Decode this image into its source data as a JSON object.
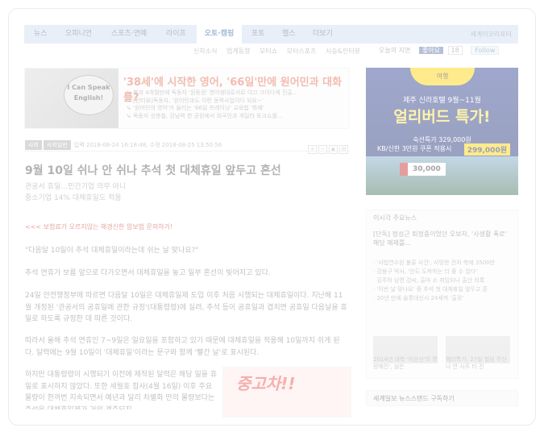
{
  "nav": {
    "items": [
      "뉴스",
      "오피니언",
      "스포츠·연예",
      "라이프",
      "오토·캠핑",
      "포토",
      "헬스",
      "더보기"
    ],
    "active": "오토·캠핑",
    "brand": "세계이코리포터"
  },
  "subnav": [
    "신차소식",
    "업계동향",
    "모터쇼",
    "모터스포츠",
    "시승&인터뷰"
  ],
  "social": {
    "today": "오늘의 지면",
    "facebook": "좋아요",
    "count": "18",
    "twitter": "Follow"
  },
  "promo": {
    "bubble_line1": "I Can Speak",
    "bubble_line2": "English!",
    "headline": "'38세'에 시작한 영어, '66일'만에 원어민과 대화를?",
    "items": [
      "볼과 4개월만에 독동자 '원동점' 영어생대로서로 이끄 크이다게 진출..",
      "[인터뷰]독동자, '원어민과도 이런 동력사업이다 되요~'",
      "'원어민의 영어'가 들리는 '66일 프레이닝' 교육법 '화제'",
      "독동자 성층철, 강남력 한 공원에서 외국인과 게릴라 토크쇼를..."
    ]
  },
  "article": {
    "tags": [
      "사회",
      "사회일반"
    ],
    "dates": "입력 2018-08-24 16:18:48, 수정 2018-08-25 13:50:56",
    "title": "9월 10일 쉬나 안 쉬나 추석 첫 대체휴일 앞두고 혼선",
    "subtitle1": "관공서 휴일…민간기업 의무 아니",
    "subtitle2": "중소기업 14% 대체휴일도 적용",
    "promo_line": "<<< 보험료가 오르지않는 해경신한 암보험 문의하기! ",
    "p1": "\"다음달 10일이 추석 대체휴일이라는데 쉬는 날 맞나요?\"",
    "p2": "추석 연휴가 보름 앞으로 다가오면서 대체휴일을 놓고 일부 혼선이 빚어지고 있다.",
    "p3": "24일 안전행정부에 따르면 다음달 10일은 대체휴일제 도입 이후 처음 시행되는 대체휴일이다. 지난해 11월 개정된 '관공서의 공휴일에 관한 규정'(대통령령)에 실려, 추석 등이 공휴일과 겹치면 공휴일 다음날을 휴일로 하도록 규정한 데 따른 것이다.",
    "p4": "따라서 올해 추석 연휴인 7∼9일은 일요일을 포함하고 있기 때문에 대체휴일을 적용해 10일까지 쉬게 된다. 달력에는 9월 10일이 '대체휴일'이라는 문구와 함께 '빨간 날'로 표시된다.",
    "p5": "하지만 대통령령이 시행되기 이전에 제작된 달력은 해당 일을 휴일로 표시하지 않았다. 또한 세월호 참사(4월 16일) 이후 주요 물량이 한꺼번 지속되면서 예년과 달리 차별화 만의 물량보다는 주석을 대체휴일제가 거의 계주되지"
  },
  "ad_bottom": {
    "text": "중고차!!"
  },
  "right_ad": {
    "top": "여행",
    "line1": "제주 신라호텔 9월~11월",
    "line2": "얼리버드 특가!",
    "line3": "숙선특가 329,000원",
    "line4": "KB/신한 3만원 쿠폰 적용시",
    "price": "299,000원",
    "coupon": "30,000"
  },
  "right_news": {
    "heading": "이시각 주요뉴스",
    "lead": "[단독] 정성근 퇴정중이었던 오보자, '사생활 폭로' 해당 매체를...",
    "items": [
      "'사법연수원 불륜 사건', 사망한 전처 측에 3500만",
      "강용구 박사, '인도 도착하는 더 좋 수 있다'",
      "김주하 남편 강씨, 출마 소 취임되나 출산 의록",
      "'이번 날 맞나요' 중 추석 첫 대체휴일 앞두고 혼",
      "20년 만에 솔롯대신시 24세까 '출정'"
    ],
    "thumb1_caption": "2014년 대학 '이순신'의 명량해전', 실은",
    "thumb2_caption": "혜리특가, 27일 협심 무산 나 연 사주 타 진"
  },
  "newsstand": {
    "label": "세계일보 뉴스스탠드 구독하기"
  }
}
